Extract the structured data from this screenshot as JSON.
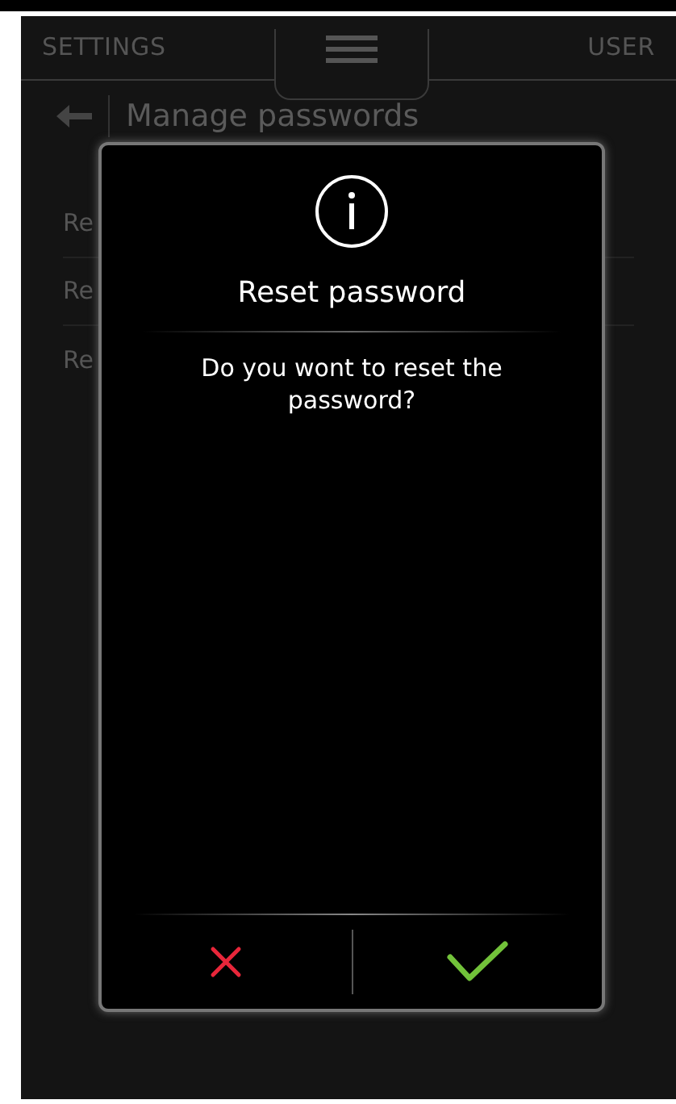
{
  "header": {
    "left": "SETTINGS",
    "right": "USER"
  },
  "page": {
    "title": "Manage passwords",
    "items": [
      "Re",
      "Re",
      "Re"
    ]
  },
  "dialog": {
    "title": "Reset password",
    "message": "Do you wont to reset the password?"
  }
}
